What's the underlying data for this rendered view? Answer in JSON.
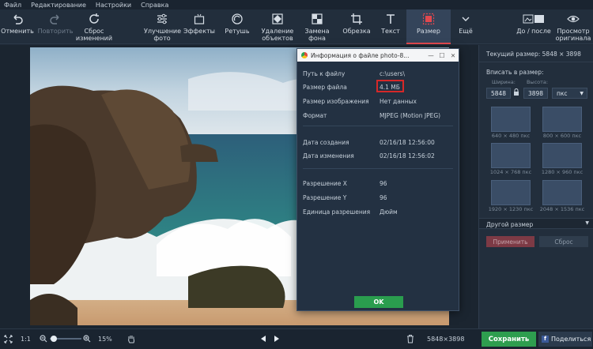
{
  "menu": [
    "Файл",
    "Редактирование",
    "Настройки",
    "Справка"
  ],
  "toolbar": {
    "undo": "Отменить",
    "redo": "Повторить",
    "reset": "Сброс изменений",
    "enhance": "Улучшение фото",
    "effects": "Эффекты",
    "retouch": "Ретушь",
    "remove_objects": "Удаление объектов",
    "replace_bg": "Замена фона",
    "crop": "Обрезка",
    "text": "Текст",
    "resize": "Размер",
    "more": "Ещё",
    "before_after": "До / после",
    "view_original": "Просмотр оригинала"
  },
  "dialog": {
    "title": "Информация о файле photo-8...",
    "rows": [
      {
        "label": "Путь к файлу",
        "value": "c:\\users\\"
      },
      {
        "label": "Размер файла",
        "value": "4.1 МБ"
      },
      {
        "label": "Размер изображения",
        "value": "Нет данных"
      },
      {
        "label": "Формат",
        "value": "MJPEG (Motion JPEG)"
      },
      {
        "label": "Дата создания",
        "value": "02/16/18 12:56:00"
      },
      {
        "label": "Дата изменения",
        "value": "02/16/18 12:56:02"
      },
      {
        "label": "Разрешение X",
        "value": "96"
      },
      {
        "label": "Разрешение Y",
        "value": "96"
      },
      {
        "label": "Единица разрешения",
        "value": "Дюйм"
      }
    ],
    "ok": "OK"
  },
  "panel": {
    "current_size": "Текущий размер: 5848 × 3898",
    "fit_to": "Вписать в размер:",
    "width_label": "Ширина:",
    "height_label": "Высота:",
    "width_value": "5848",
    "height_value": "3898",
    "unit": "пкс",
    "presets": [
      "640 × 480 пкс",
      "800 × 600 пкс",
      "1024 × 768 пкс",
      "1280 × 960 пкс",
      "1920 × 1230 пкс",
      "2048 × 1536 пкс"
    ],
    "other_size": "Другой размер",
    "apply": "Применить",
    "reset": "Сброс"
  },
  "status": {
    "fit": "1:1",
    "zoom": "15%",
    "dimensions": "5848×3898",
    "save": "Сохранить",
    "share": "Поделиться"
  },
  "colors": {
    "accent_red": "#e0484e",
    "save_green": "#2e9e4f",
    "ok_green": "#2a9d4e",
    "highlight_box": "#d62828"
  }
}
